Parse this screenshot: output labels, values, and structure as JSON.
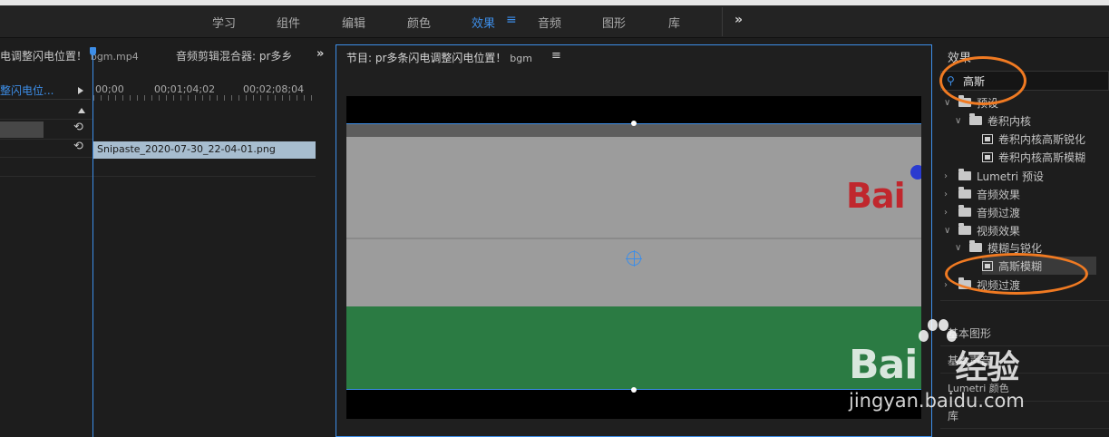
{
  "workspace_tabs": [
    {
      "label": "学习",
      "active": false
    },
    {
      "label": "组件",
      "active": false
    },
    {
      "label": "编辑",
      "active": false
    },
    {
      "label": "颜色",
      "active": false
    },
    {
      "label": "效果",
      "active": true
    },
    {
      "label": "音频",
      "active": false
    },
    {
      "label": "图形",
      "active": false
    },
    {
      "label": "库",
      "active": false
    }
  ],
  "workspace_menu_icon": "hamburger-icon",
  "workspace_more_glyph": "»",
  "left_panel": {
    "tab_1": "电调整闪电位置！",
    "tab_1_sub": "bgm.mp4",
    "tab_2": "音频剪辑混合器: pr多乡",
    "more_glyph": "»",
    "track_label": "整闪电位...",
    "timecodes": [
      "00;00",
      "00;01;04;02",
      "00;02;08;04"
    ],
    "clip_name": "Snipaste_2020-07-30_22-04-01.png",
    "reset_glyph": "⟲"
  },
  "program_monitor": {
    "title": "节目: pr多条闪电调整闪电位置！",
    "title_sub": "bgm",
    "menu_glyph": "≡",
    "logo_text": "Bai"
  },
  "effects_panel": {
    "title": "效果",
    "search_icon": "search-icon",
    "search_value": "高斯",
    "tree": [
      {
        "label": "预设",
        "kind": "folder",
        "depth": 0,
        "expanded": true
      },
      {
        "label": "卷积内核",
        "kind": "folder",
        "depth": 1,
        "expanded": true
      },
      {
        "label": "卷积内核高斯锐化",
        "kind": "effect",
        "depth": 2
      },
      {
        "label": "卷积内核高斯模糊",
        "kind": "effect",
        "depth": 2
      },
      {
        "label": "Lumetri 预设",
        "kind": "folder",
        "depth": 0,
        "expanded": false
      },
      {
        "label": "音频效果",
        "kind": "folder",
        "depth": 0,
        "expanded": false
      },
      {
        "label": "音频过渡",
        "kind": "folder",
        "depth": 0,
        "expanded": false
      },
      {
        "label": "视频效果",
        "kind": "folder",
        "depth": 0,
        "expanded": true
      },
      {
        "label": "模糊与锐化",
        "kind": "folder",
        "depth": 1,
        "expanded": true
      },
      {
        "label": "高斯模糊",
        "kind": "effect",
        "depth": 2,
        "highlighted": true
      },
      {
        "label": "视频过渡",
        "kind": "folder",
        "depth": 0,
        "expanded": false
      }
    ],
    "lower_panels": [
      "基本图形",
      "基本声音",
      "Lumetri 颜色",
      "库"
    ]
  },
  "watermark": {
    "text": "Bai",
    "text_suffix": "经验",
    "sub": "jingyan.baidu.com"
  },
  "colors": {
    "accent": "#3d8ee8",
    "annotation": "#f07a22",
    "clip": "#a7bdcf",
    "green_band": "#2b7b43"
  }
}
